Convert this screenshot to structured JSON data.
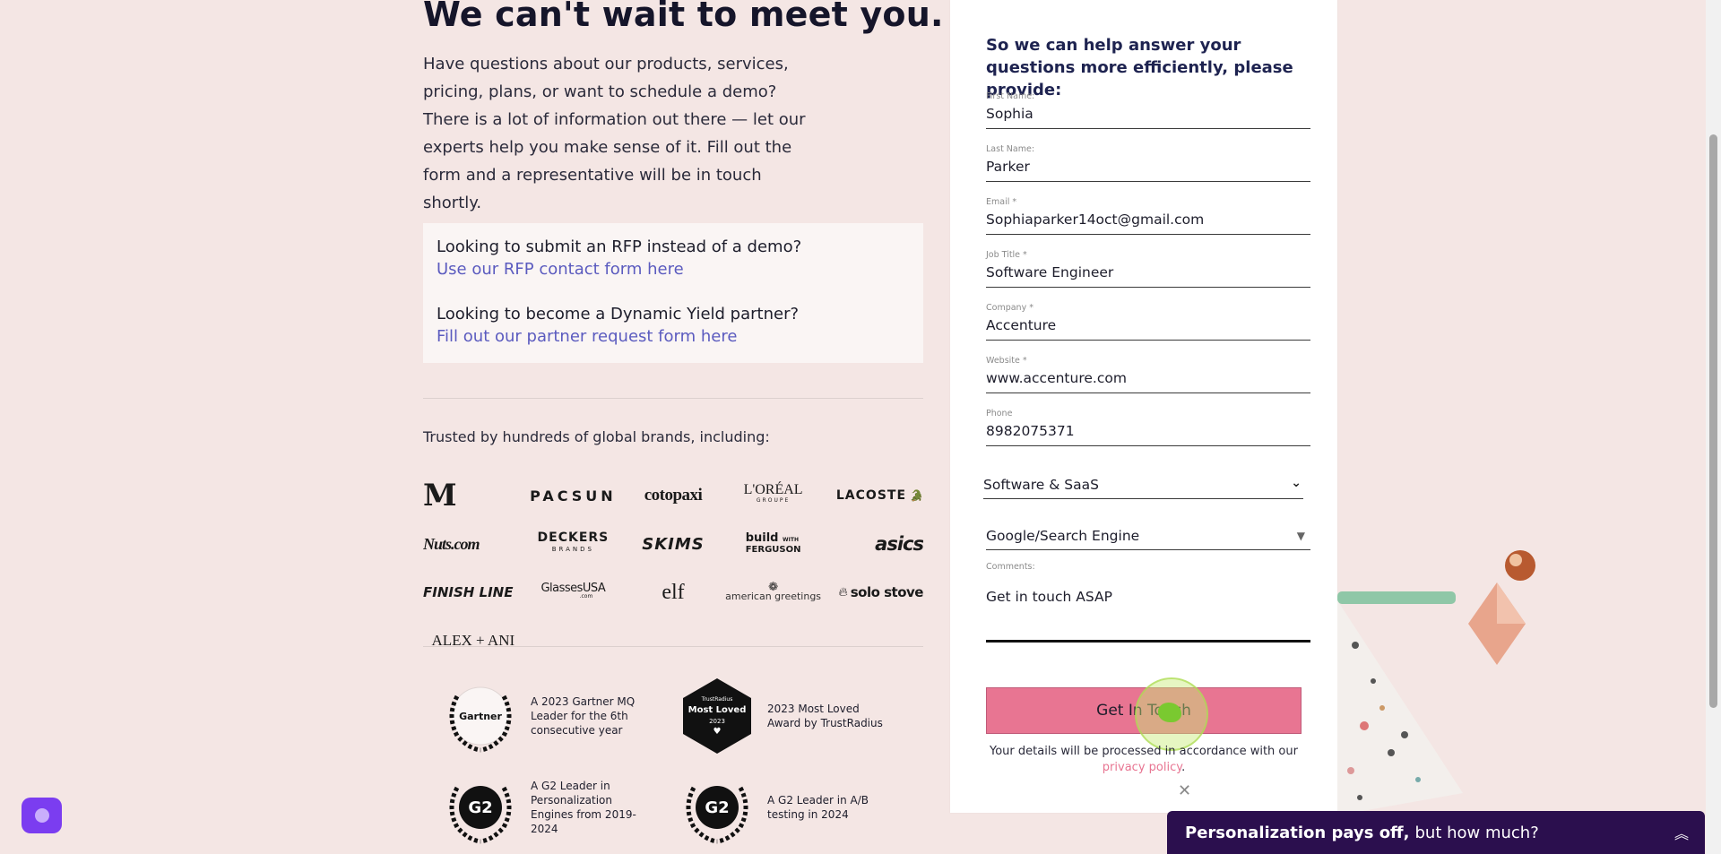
{
  "hero": {
    "title": "We can't wait to meet you.",
    "description": "Have questions about our products, services, pricing, plans, or want to schedule a demo? There is a lot of information out there — let our experts help you make sense of it. Fill out the form and a representative will be in touch shortly."
  },
  "info_box": {
    "rfp_question": "Looking to submit an RFP instead of a demo?",
    "rfp_link": "Use our RFP contact form here",
    "partner_question": "Looking to become a Dynamic Yield partner?",
    "partner_link": "Fill out our partner request form here"
  },
  "trusted": {
    "label": "Trusted by hundreds of global brands, including:",
    "logos": [
      "McDonald's",
      "PACSUN",
      "cotopaxi",
      "L'ORÉAL",
      "LACOSTE",
      "Nuts.com",
      "DECKERS",
      "SKIMS",
      "build with FERGUSON",
      "asics",
      "FINISH LINE",
      "GlassesUSA",
      "elf",
      "american greetings",
      "solo stove",
      "ALEX + ANI"
    ],
    "logo_text": {
      "mcd": "M",
      "pacsun": "PACSUN",
      "cotopaxi": "cotopaxi",
      "loreal": "L'ORÉAL",
      "loreal_sub": "GROUPE",
      "lacoste": "LACOSTE",
      "nuts": "Nuts.com",
      "deckers": "DECKERS",
      "deckers_sub": "BRANDS",
      "skims": "SKIMS",
      "build": "build",
      "build_with": "WITH",
      "ferguson": "FERGUSON",
      "asics": "asics",
      "finishline": "FINISH LINE",
      "glasses": "GlassesUSA",
      "glasses_sub": ".com",
      "elf": "elf",
      "american": "american greetings",
      "solostove": "solo stove",
      "alexani": "ALEX + ANI"
    }
  },
  "awards": [
    {
      "badge": "Gartner",
      "text": "A 2023 Gartner MQ Leader for the 6th consecutive year"
    },
    {
      "badge_top": "TrustRadius",
      "badge": "Most Loved",
      "badge_year": "2023",
      "text": "2023 Most Loved Award by TrustRadius"
    },
    {
      "badge": "G2",
      "text": "A G2 Leader in Personalization Engines from 2019-2024"
    },
    {
      "badge": "G2",
      "text": "A G2 Leader in A/B testing in 2024"
    }
  ],
  "form": {
    "heading": "So we can help answer your questions more efficiently, please provide:",
    "fields": [
      {
        "label": "First Name:",
        "value": "Sophia"
      },
      {
        "label": "Last Name:",
        "value": "Parker"
      },
      {
        "label": "Email *",
        "value": "Sophiaparker14oct@gmail.com"
      },
      {
        "label": "Job Title *",
        "value": "Software Engineer"
      },
      {
        "label": "Company *",
        "value": "Accenture"
      },
      {
        "label": "Website *",
        "value": "www.accenture.com"
      },
      {
        "label": "Phone",
        "value": "8982075371"
      }
    ],
    "industry": "Software & SaaS",
    "source": "Google/Search Engine",
    "comments_label": "Comments:",
    "comments_value": "Get in touch ASAP",
    "submit_label": "Get In Touch",
    "privacy_prefix": "Your details will be processed in accordance with our",
    "privacy_link": "privacy policy",
    "privacy_suffix": ".",
    "close": "✕"
  },
  "promo": {
    "strong": "Personalization pays off,",
    "rest": "but how much?",
    "caret": "⌃"
  },
  "colors": {
    "background": "#f4e6e4",
    "accent_pink": "#e87592",
    "link_blue": "#5b5bbf",
    "promo_bg": "#2b0f4e",
    "chat_purple": "#7b3df0"
  }
}
